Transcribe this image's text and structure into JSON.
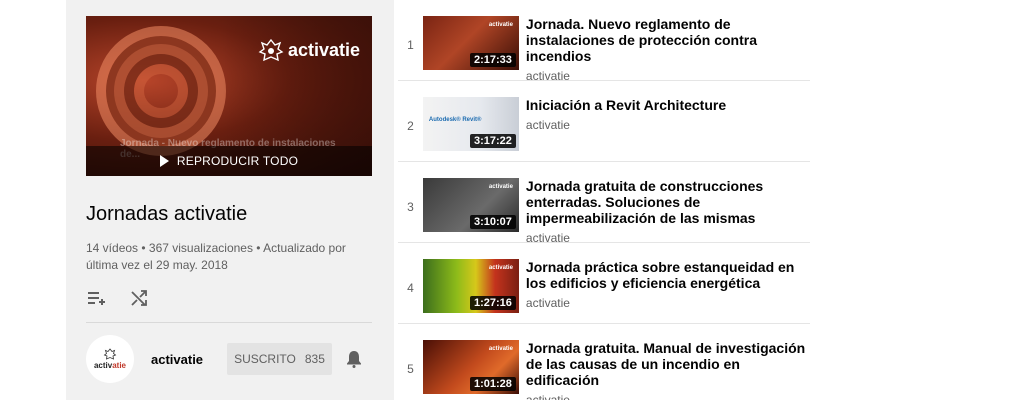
{
  "playlist": {
    "hero_logo_text": "activatie",
    "hero_overlay_text": "Jornada - Nuevo reglamento de instalaciones de...",
    "play_all_label": "REPRODUCIR TODO",
    "title": "Jornadas activatie",
    "meta": "14 vídeos • 367 visualizaciones • Actualizado por última vez el 29 may. 2018",
    "owner": {
      "name": "activatie",
      "avatar_text_black": "activ",
      "avatar_text_red": "atie",
      "subscribe_label": "SUSCRITO",
      "subscriber_count": "835"
    }
  },
  "videos": [
    {
      "index": "1",
      "title": "Jornada. Nuevo reglamento de instalaciones de protección contra incendios",
      "channel": "activatie",
      "duration": "2:17:33",
      "thumb_logo": "activatie"
    },
    {
      "index": "2",
      "title": "Iniciación a Revit Architecture",
      "channel": "activatie",
      "duration": "3:17:22",
      "thumb_logo": "Autodesk® Revit®"
    },
    {
      "index": "3",
      "title": "Jornada gratuita de construcciones enterradas. Soluciones de impermeabilización de las mismas",
      "channel": "activatie",
      "duration": "3:10:07",
      "thumb_logo": "activatie"
    },
    {
      "index": "4",
      "title": "Jornada práctica sobre estanqueidad en los edificios y eficiencia energética",
      "channel": "activatie",
      "duration": "1:27:16",
      "thumb_logo": "activatie"
    },
    {
      "index": "5",
      "title": "Jornada gratuita. Manual de investigación de las causas de un incendio en edificación",
      "channel": "activatie",
      "duration": "1:01:28",
      "thumb_logo": "activatie"
    }
  ],
  "icons": {
    "add_to_queue": "playlist-add-icon",
    "shuffle": "shuffle-icon",
    "bell": "bell-icon",
    "play": "play-icon"
  }
}
